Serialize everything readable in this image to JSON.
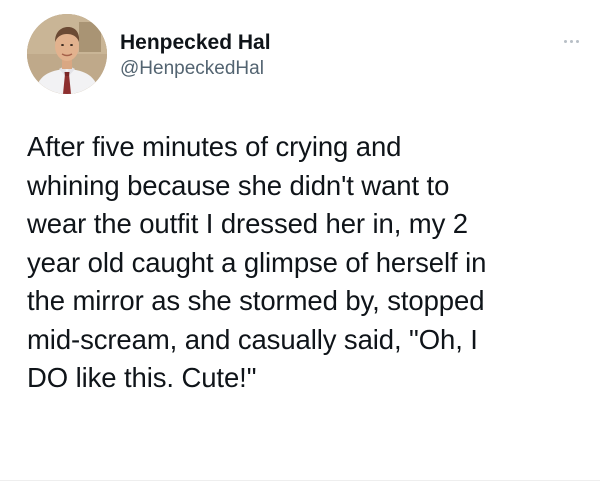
{
  "author": {
    "display_name": "Henpecked Hal",
    "handle": "@HenpeckedHal",
    "avatar_icon": "profile-photo"
  },
  "menu": {
    "icon": "more-options-icon"
  },
  "tweet": {
    "lines": [
      "After five minutes of crying and",
      "whining because she didn't want to",
      "wear the outfit I dressed her in, my 2",
      "year old caught a glimpse of herself in",
      "the mirror as she stormed by, stopped",
      "mid-scream, and casually said, \"Oh, I",
      "DO like this. Cute!\""
    ]
  },
  "colors": {
    "text": "#0f1419",
    "secondary": "#536471",
    "background": "#ffffff"
  }
}
